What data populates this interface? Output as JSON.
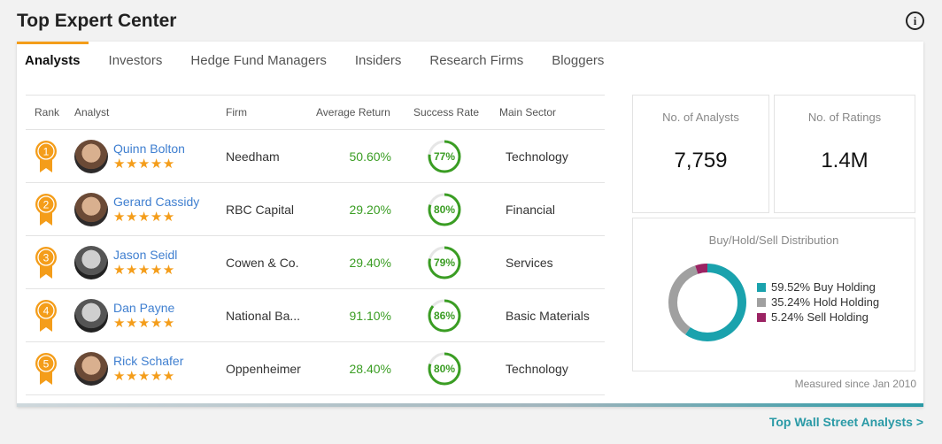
{
  "header": {
    "title": "Top Expert Center",
    "info_icon": "info-icon",
    "info_glyph": "i"
  },
  "tabs": [
    {
      "label": "Analysts",
      "active": true
    },
    {
      "label": "Investors",
      "active": false
    },
    {
      "label": "Hedge Fund Managers",
      "active": false
    },
    {
      "label": "Insiders",
      "active": false
    },
    {
      "label": "Research Firms",
      "active": false
    },
    {
      "label": "Bloggers",
      "active": false
    }
  ],
  "table": {
    "headers": {
      "rank": "Rank",
      "analyst": "Analyst",
      "firm": "Firm",
      "avg_return": "Average Return",
      "success_rate": "Success Rate",
      "main_sector": "Main Sector"
    },
    "rows": [
      {
        "rank": "1",
        "name": "Quinn Bolton",
        "stars": "★★★★★",
        "firm": "Needham",
        "avg_return": "50.60%",
        "success_rate": "77%",
        "success_value": 77,
        "sector": "Technology"
      },
      {
        "rank": "2",
        "name": "Gerard Cassidy",
        "stars": "★★★★★",
        "firm": "RBC Capital",
        "avg_return": "29.20%",
        "success_rate": "80%",
        "success_value": 80,
        "sector": "Financial"
      },
      {
        "rank": "3",
        "name": "Jason Seidl",
        "stars": "★★★★★",
        "firm": "Cowen & Co.",
        "avg_return": "29.40%",
        "success_rate": "79%",
        "success_value": 79,
        "sector": "Services"
      },
      {
        "rank": "4",
        "name": "Dan Payne",
        "stars": "★★★★★",
        "firm": "National Ba...",
        "avg_return": "91.10%",
        "success_rate": "86%",
        "success_value": 86,
        "sector": "Basic Materials"
      },
      {
        "rank": "5",
        "name": "Rick Schafer",
        "stars": "★★★★★",
        "firm": "Oppenheimer",
        "avg_return": "28.40%",
        "success_rate": "80%",
        "success_value": 80,
        "sector": "Technology"
      }
    ]
  },
  "stats": {
    "analysts": {
      "label": "No. of Analysts",
      "value": "7,759"
    },
    "ratings": {
      "label": "No. of Ratings",
      "value": "1.4M"
    }
  },
  "distribution": {
    "title": "Buy/Hold/Sell Distribution",
    "items": [
      {
        "label": "59.52% Buy Holding",
        "value": 59.52,
        "color": "#1aa2ad"
      },
      {
        "label": "35.24% Hold Holding",
        "value": 35.24,
        "color": "#a0a0a0"
      },
      {
        "label": "5.24% Sell Holding",
        "value": 5.24,
        "color": "#9b2363"
      }
    ]
  },
  "colors": {
    "accent": "#f49d1a",
    "link": "#3f7fd0",
    "positive": "#3a9d23",
    "teal": "#2a9aa6"
  },
  "measured_since": "Measured since Jan 2010",
  "footer": {
    "link_label": "Top Wall Street Analysts >"
  }
}
